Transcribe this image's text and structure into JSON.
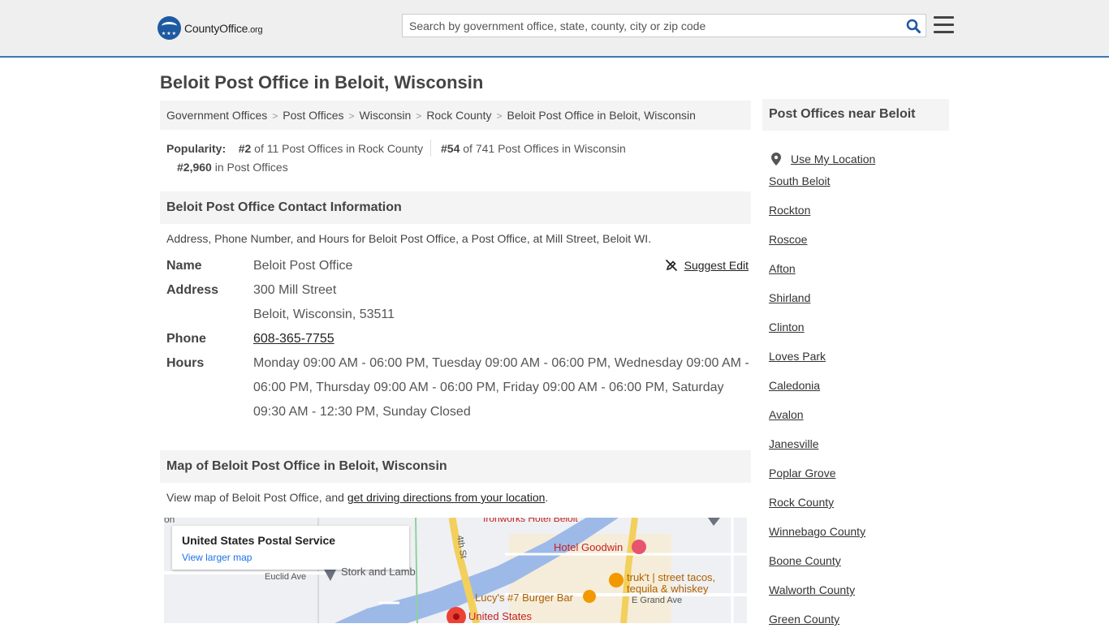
{
  "header": {
    "logo_main": "CountyOffice",
    "logo_tld": ".org",
    "search_placeholder": "Search by government office, state, county, city or zip code"
  },
  "page_title": "Beloit Post Office in Beloit, Wisconsin",
  "breadcrumb": [
    "Government Offices",
    "Post Offices",
    "Wisconsin",
    "Rock County",
    "Beloit Post Office in Beloit, Wisconsin"
  ],
  "popularity": {
    "label": "Popularity:",
    "rank1": "#2",
    "rank1_text": "of 11 Post Offices in Rock County",
    "rank2": "#54",
    "rank2_text": "of 741 Post Offices in Wisconsin",
    "rank3": "#2,960",
    "rank3_text": "in Post Offices"
  },
  "contact": {
    "heading": "Beloit Post Office Contact Information",
    "intro": "Address, Phone Number, and Hours for Beloit Post Office, a Post Office, at Mill Street, Beloit WI.",
    "suggest_edit": "Suggest Edit",
    "name_label": "Name",
    "name": "Beloit Post Office",
    "address_label": "Address",
    "address_line1": "300 Mill Street",
    "address_line2": "Beloit, Wisconsin, 53511",
    "phone_label": "Phone",
    "phone": "608-365-7755",
    "hours_label": "Hours",
    "hours": "Monday 09:00 AM - 06:00 PM, Tuesday 09:00 AM - 06:00 PM, Wednesday 09:00 AM - 06:00 PM, Thursday 09:00 AM - 06:00 PM, Friday 09:00 AM - 06:00 PM, Saturday 09:30 AM - 12:30 PM, Sunday Closed"
  },
  "map_section": {
    "heading": "Map of Beloit Post Office in Beloit, Wisconsin",
    "intro_prefix": "View map of Beloit Post Office, and ",
    "intro_link": "get driving directions from your location",
    "intro_suffix": ".",
    "card_title": "United States Postal Service",
    "card_link": "View larger map",
    "labels": {
      "hotel_goodwin": "Hotel Goodwin",
      "ironworks": "Ironworks Hotel Beloit",
      "stork": "Stork and Lamb",
      "euclid": "Euclid Ave",
      "fourth_st": "4th St",
      "truk_line1": "truk't | street tacos,",
      "truk_line2": "tequila & whiskey",
      "lucys": "Lucy's #7 Burger Bar",
      "grand": "E Grand Ave",
      "usps": "United States",
      "on": "on"
    }
  },
  "sidebar": {
    "heading": "Post Offices near Beloit",
    "use_location": "Use My Location",
    "items": [
      "South Beloit",
      "Rockton",
      "Roscoe",
      "Afton",
      "Shirland",
      "Clinton",
      "Loves Park",
      "Caledonia",
      "Avalon",
      "Janesville",
      "Poplar Grove",
      "Rock County",
      "Winnebago County",
      "Boone County",
      "Walworth County",
      "Green County"
    ]
  }
}
